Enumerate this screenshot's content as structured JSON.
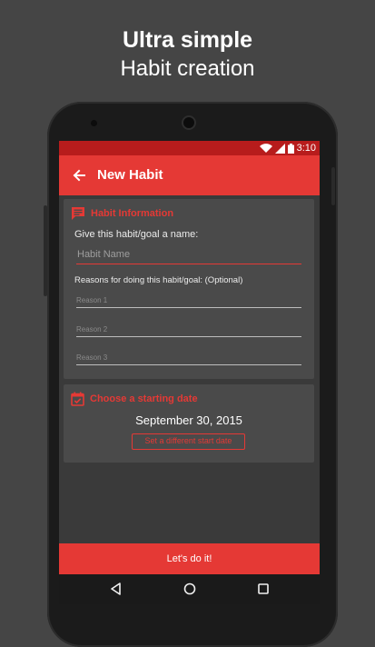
{
  "promo": {
    "line1": "Ultra simple",
    "line2": "Habit creation"
  },
  "status_bar": {
    "time": "3:10",
    "icons": [
      "wifi-icon",
      "signal-icon",
      "battery-icon"
    ]
  },
  "app_bar": {
    "title": "New Habit",
    "back_icon": "arrow-back-icon"
  },
  "habit_info": {
    "header": "Habit Information",
    "icon": "message-lines-icon",
    "name_label": "Give this habit/goal a name:",
    "name_placeholder": "Habit Name",
    "reasons_label": "Reasons for doing this habit/goal: (Optional)",
    "reasons": [
      "Reason 1",
      "Reason 2",
      "Reason 3"
    ]
  },
  "start_date": {
    "header": "Choose a starting date",
    "icon": "calendar-check-icon",
    "date": "September 30, 2015",
    "button_label": "Set a different start date"
  },
  "action": {
    "label": "Let's do it!"
  },
  "nav": {
    "icons": [
      "nav-back-icon",
      "nav-home-icon",
      "nav-recent-icon"
    ]
  },
  "colors": {
    "accent": "#e53935",
    "status_bar": "#b71c1c",
    "background": "#454545",
    "card": "#4a4a4a",
    "screen": "#3a3a3a"
  }
}
